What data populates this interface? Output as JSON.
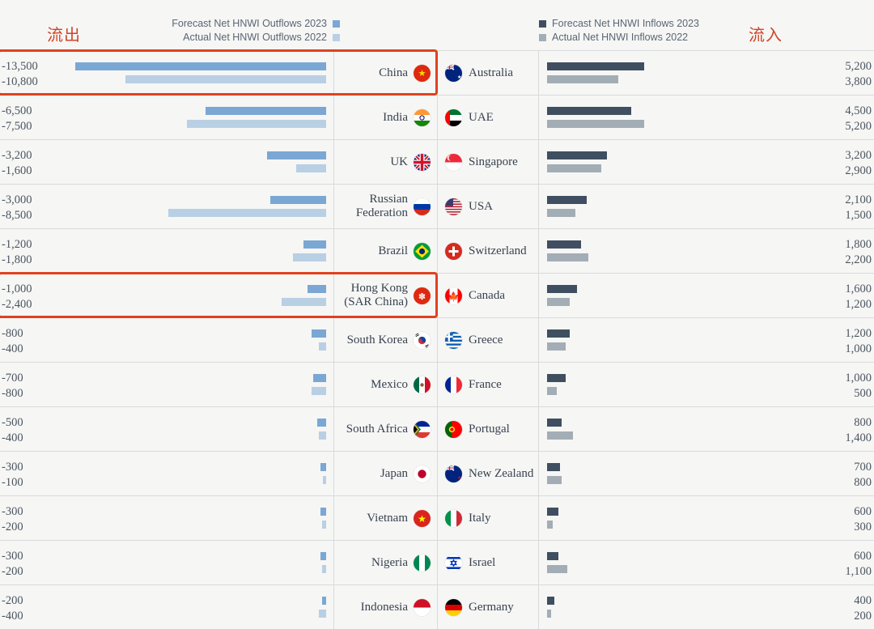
{
  "labels": {
    "outflow_cn": "流出",
    "inflow_cn": "流入"
  },
  "legend": {
    "left": [
      {
        "label": "Forecast Net HNWI Outflows 2023",
        "color": "#7ba7d4",
        "swatch": "legend-swatch"
      },
      {
        "label": "Actual Net HNWI Outflows 2022",
        "color": "#b9cfe4",
        "swatch": "legend-swatch"
      }
    ],
    "right": [
      {
        "label": "Forecast Net HNWI Inflows 2023",
        "color": "#3f4f61",
        "swatch": "legend-swatch"
      },
      {
        "label": "Actual Net HNWI Inflows 2022",
        "color": "#a3adb5",
        "swatch": "legend-swatch"
      }
    ]
  },
  "colors": {
    "outflow_forecast": "#7ba7d4",
    "outflow_actual": "#b9cfe4",
    "inflow_forecast": "#3f4f61",
    "inflow_actual": "#a3adb5",
    "highlight": "#e0411f",
    "accent_text": "#cf4528"
  },
  "chart_data": {
    "type": "bar",
    "title": "",
    "xlabel": "",
    "ylabel": "",
    "grid": false,
    "legend_position": "top",
    "axis_max_abs": 13500,
    "series": [
      {
        "name": "Forecast Net HNWI Outflows 2023",
        "side": "left",
        "color": "#7ba7d4"
      },
      {
        "name": "Actual Net HNWI Outflows 2022",
        "side": "left",
        "color": "#b9cfe4"
      },
      {
        "name": "Forecast Net HNWI Inflows 2023",
        "side": "right",
        "color": "#3f4f61"
      },
      {
        "name": "Actual Net HNWI Inflows 2022",
        "side": "right",
        "color": "#a3adb5"
      }
    ],
    "rows": [
      {
        "highlight": true,
        "out_country": "China",
        "out_flag": "cn",
        "out_forecast_label": "-13,500",
        "out_actual_label": "-10,800",
        "out_forecast": -13500,
        "out_actual": -10800,
        "in_country": "Australia",
        "in_flag": "au",
        "in_forecast_label": "5,200",
        "in_actual_label": "3,800",
        "in_forecast": 5200,
        "in_actual": 3800
      },
      {
        "highlight": false,
        "out_country": "India",
        "out_flag": "in",
        "out_forecast_label": "-6,500",
        "out_actual_label": "-7,500",
        "out_forecast": -6500,
        "out_actual": -7500,
        "in_country": "UAE",
        "in_flag": "ae",
        "in_forecast_label": "4,500",
        "in_actual_label": "5,200",
        "in_forecast": 4500,
        "in_actual": 5200
      },
      {
        "highlight": false,
        "out_country": "UK",
        "out_flag": "gb",
        "out_forecast_label": "-3,200",
        "out_actual_label": "-1,600",
        "out_forecast": -3200,
        "out_actual": -1600,
        "in_country": "Singapore",
        "in_flag": "sg",
        "in_forecast_label": "3,200",
        "in_actual_label": "2,900",
        "in_forecast": 3200,
        "in_actual": 2900
      },
      {
        "highlight": false,
        "out_country": "Russian Federation",
        "out_flag": "ru",
        "out_forecast_label": "-3,000",
        "out_actual_label": "-8,500",
        "out_forecast": -3000,
        "out_actual": -8500,
        "in_country": "USA",
        "in_flag": "us",
        "in_forecast_label": "2,100",
        "in_actual_label": "1,500",
        "in_forecast": 2100,
        "in_actual": 1500
      },
      {
        "highlight": false,
        "out_country": "Brazil",
        "out_flag": "br",
        "out_forecast_label": "-1,200",
        "out_actual_label": "-1,800",
        "out_forecast": -1200,
        "out_actual": -1800,
        "in_country": "Switzerland",
        "in_flag": "ch",
        "in_forecast_label": "1,800",
        "in_actual_label": "2,200",
        "in_forecast": 1800,
        "in_actual": 2200
      },
      {
        "highlight": true,
        "out_country": "Hong Kong (SAR China)",
        "out_flag": "hk",
        "out_forecast_label": "-1,000",
        "out_actual_label": "-2,400",
        "out_forecast": -1000,
        "out_actual": -2400,
        "in_country": "Canada",
        "in_flag": "ca",
        "in_forecast_label": "1,600",
        "in_actual_label": "1,200",
        "in_forecast": 1600,
        "in_actual": 1200
      },
      {
        "highlight": false,
        "out_country": "South Korea",
        "out_flag": "kr",
        "out_forecast_label": "-800",
        "out_actual_label": "-400",
        "out_forecast": -800,
        "out_actual": -400,
        "in_country": "Greece",
        "in_flag": "gr",
        "in_forecast_label": "1,200",
        "in_actual_label": "1,000",
        "in_forecast": 1200,
        "in_actual": 1000
      },
      {
        "highlight": false,
        "out_country": "Mexico",
        "out_flag": "mx",
        "out_forecast_label": "-700",
        "out_actual_label": "-800",
        "out_forecast": -700,
        "out_actual": -800,
        "in_country": "France",
        "in_flag": "fr",
        "in_forecast_label": "1,000",
        "in_actual_label": "500",
        "in_forecast": 1000,
        "in_actual": 500
      },
      {
        "highlight": false,
        "out_country": "South Africa",
        "out_flag": "za",
        "out_forecast_label": "-500",
        "out_actual_label": "-400",
        "out_forecast": -500,
        "out_actual": -400,
        "in_country": "Portugal",
        "in_flag": "pt",
        "in_forecast_label": "800",
        "in_actual_label": "1,400",
        "in_forecast": 800,
        "in_actual": 1400
      },
      {
        "highlight": false,
        "out_country": "Japan",
        "out_flag": "jp",
        "out_forecast_label": "-300",
        "out_actual_label": "-100",
        "out_forecast": -300,
        "out_actual": -100,
        "in_country": "New Zealand",
        "in_flag": "nz",
        "in_forecast_label": "700",
        "in_actual_label": "800",
        "in_forecast": 700,
        "in_actual": 800
      },
      {
        "highlight": false,
        "out_country": "Vietnam",
        "out_flag": "vn",
        "out_forecast_label": "-300",
        "out_actual_label": "-200",
        "out_forecast": -300,
        "out_actual": -200,
        "in_country": "Italy",
        "in_flag": "it",
        "in_forecast_label": "600",
        "in_actual_label": "300",
        "in_forecast": 600,
        "in_actual": 300
      },
      {
        "highlight": false,
        "out_country": "Nigeria",
        "out_flag": "ng",
        "out_forecast_label": "-300",
        "out_actual_label": "-200",
        "out_forecast": -300,
        "out_actual": -200,
        "in_country": "Israel",
        "in_flag": "il",
        "in_forecast_label": "600",
        "in_actual_label": "1,100",
        "in_forecast": 600,
        "in_actual": 1100
      },
      {
        "highlight": false,
        "out_country": "Indonesia",
        "out_flag": "id",
        "out_forecast_label": "-200",
        "out_actual_label": "-400",
        "out_forecast": -200,
        "out_actual": -400,
        "in_country": "Germany",
        "in_flag": "de",
        "in_forecast_label": "400",
        "in_actual_label": "200",
        "in_forecast": 400,
        "in_actual": 200
      }
    ]
  }
}
